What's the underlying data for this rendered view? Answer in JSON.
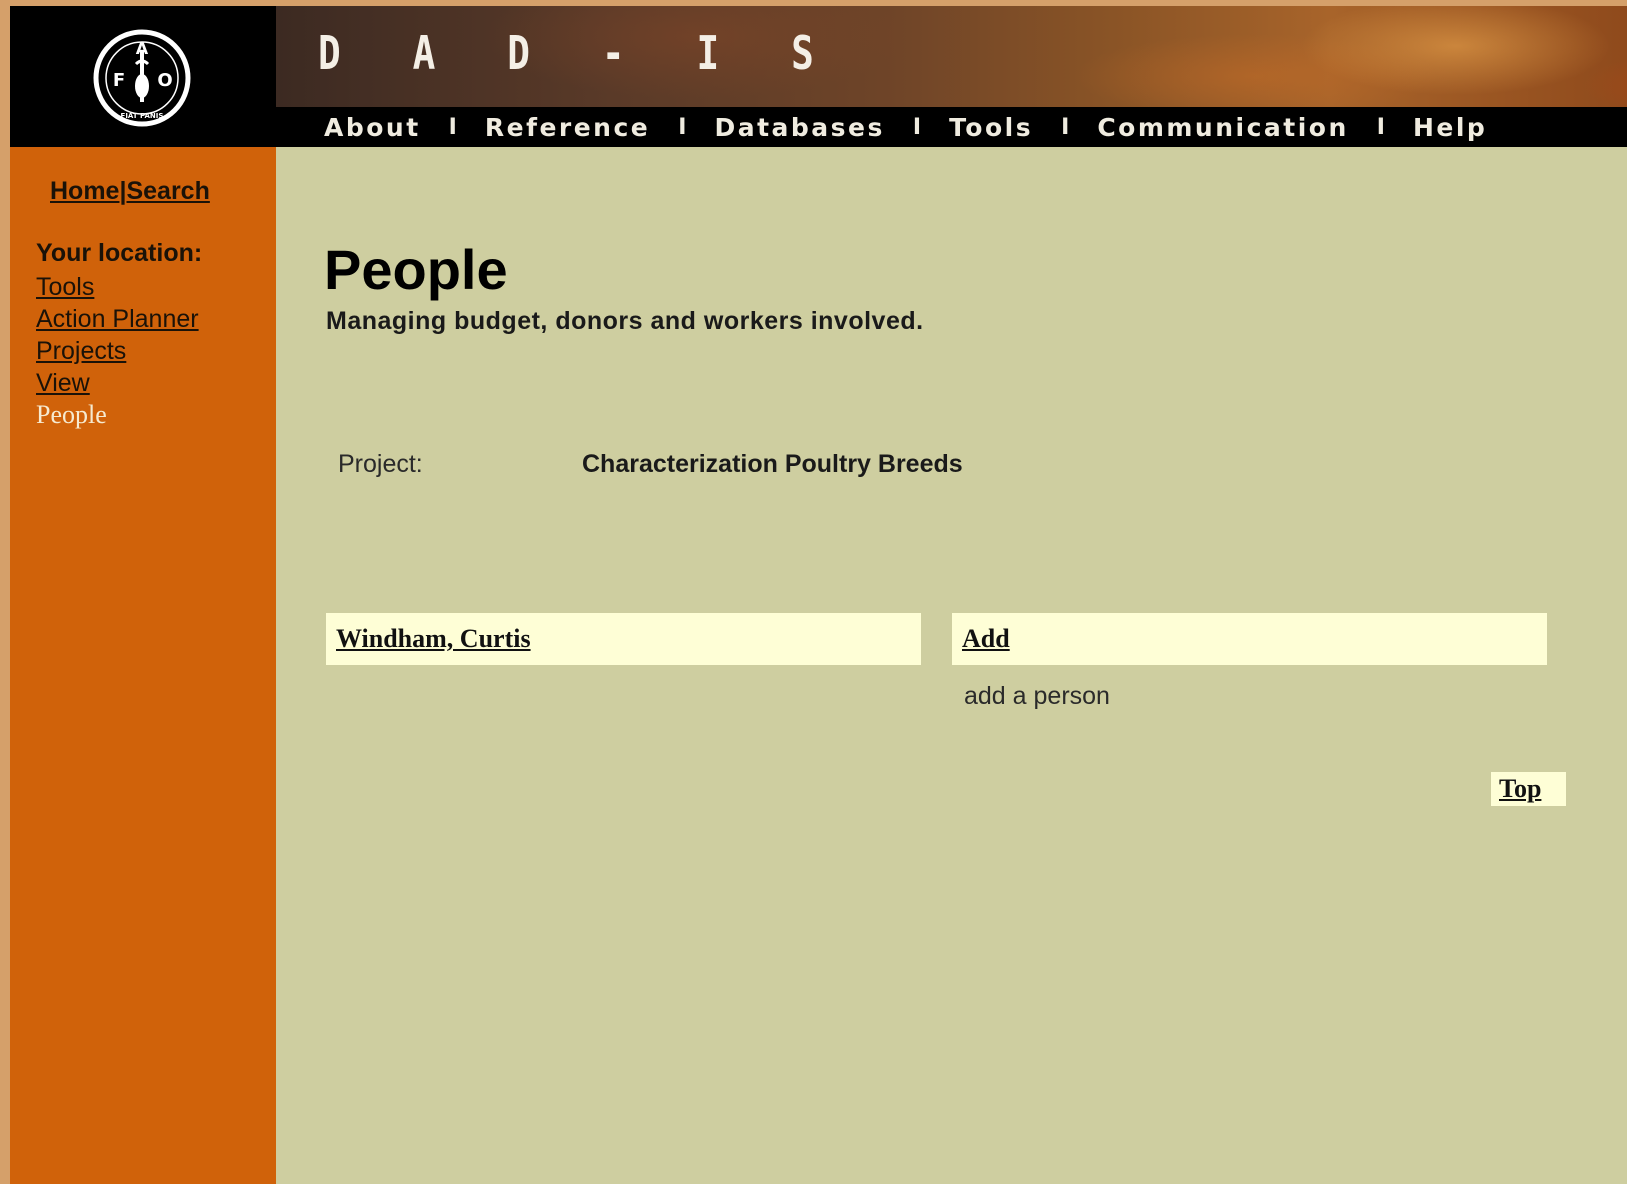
{
  "header": {
    "title": "D A D - I S",
    "logo_text": "FAO",
    "logo_motto": "FIAT PANIS",
    "nav": [
      "About",
      "Reference",
      "Databases",
      "Tools",
      "Communication",
      "Help"
    ],
    "nav_separator": "I"
  },
  "sidebar": {
    "home_label": "Home",
    "separator": "|",
    "search_label": "Search",
    "location_label": "Your location:",
    "breadcrumbs": [
      "Tools",
      "Action Planner",
      "Projects",
      "View"
    ],
    "current": "People"
  },
  "main": {
    "title": "People",
    "subtitle": "Managing budget, donors and workers involved.",
    "project_label": "Project:",
    "project_value": "Characterization Poultry Breeds",
    "person_link": "Windham, Curtis",
    "add_link": "Add",
    "add_description": "add a person",
    "top_link": "Top"
  },
  "colors": {
    "sidebar": "#d0620a",
    "content": "#ceceA0",
    "cell": "#fefed6",
    "header": "#000000"
  }
}
